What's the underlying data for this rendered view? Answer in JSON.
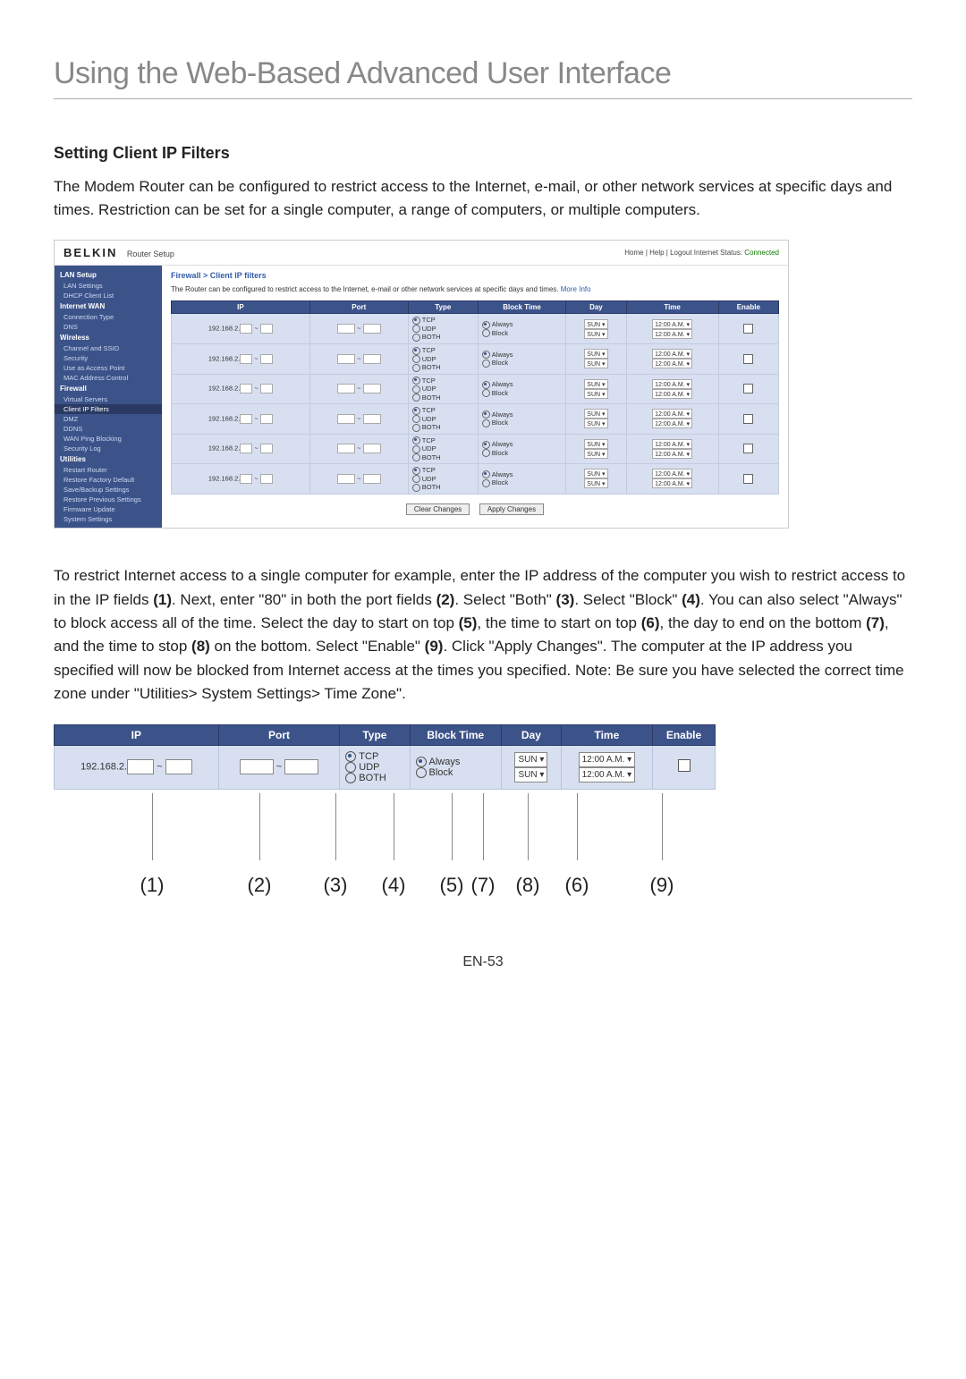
{
  "page": {
    "title": "Using the Web-Based Advanced User Interface",
    "section_title": "Setting Client IP Filters",
    "intro": "The Modem Router can be configured to restrict access to the Internet, e-mail, or other network services at specific days and times. Restriction can be set for a single computer, a range of computers, or multiple computers.",
    "instructions_parts": [
      "To restrict Internet access to a single computer for example, enter the IP address of the computer you wish to restrict access to in the IP fields ",
      "(1)",
      ". Next, enter \"80\" in both the port fields ",
      "(2)",
      ". Select \"Both\" ",
      "(3)",
      ". Select \"Block\" ",
      "(4)",
      ". You can also select \"Always\" to block access all of the time. Select the day to start on top ",
      "(5)",
      ", the time to start on top ",
      "(6)",
      ", the day to end on the bottom ",
      "(7)",
      ", and the time to stop ",
      "(8)",
      " on the bottom. Select \"Enable\" ",
      "(9)",
      ". Click \"Apply Changes\". The computer at the IP address you specified will now be blocked from Internet access at the times you specified. Note: Be sure you have selected the correct time zone under \"Utilities> System Settings> Time Zone\"."
    ],
    "footer": "EN-53"
  },
  "router": {
    "brand": "BELKIN",
    "subtitle": "Router Setup",
    "status_prefix": "Home | Help | Logout   Internet Status:",
    "status_value": "Connected",
    "breadcrumb": "Firewall > Client IP filters",
    "desc": "The Router can be configured to restrict access to the Internet, e-mail or other network services at specific days and times.",
    "more": "More Info",
    "sidebar": [
      {
        "type": "title",
        "label": "LAN Setup"
      },
      {
        "type": "item",
        "label": "LAN Settings"
      },
      {
        "type": "item",
        "label": "DHCP Client List"
      },
      {
        "type": "title",
        "label": "Internet WAN"
      },
      {
        "type": "item",
        "label": "Connection Type"
      },
      {
        "type": "item",
        "label": "DNS"
      },
      {
        "type": "title",
        "label": "Wireless"
      },
      {
        "type": "item",
        "label": "Channel and SSID"
      },
      {
        "type": "item",
        "label": "Security"
      },
      {
        "type": "item",
        "label": "Use as Access Point"
      },
      {
        "type": "item",
        "label": "MAC Address Control"
      },
      {
        "type": "title",
        "label": "Firewall"
      },
      {
        "type": "item",
        "label": "Virtual Servers"
      },
      {
        "type": "item",
        "label": "Client IP Filters",
        "active": true
      },
      {
        "type": "item",
        "label": "DMZ"
      },
      {
        "type": "item",
        "label": "DDNS"
      },
      {
        "type": "item",
        "label": "WAN Ping Blocking"
      },
      {
        "type": "item",
        "label": "Security Log"
      },
      {
        "type": "title",
        "label": "Utilities"
      },
      {
        "type": "item",
        "label": "Restart Router"
      },
      {
        "type": "item",
        "label": "Restore Factory Default"
      },
      {
        "type": "item",
        "label": "Save/Backup Settings"
      },
      {
        "type": "item",
        "label": "Restore Previous Settings"
      },
      {
        "type": "item",
        "label": "Firmware Update"
      },
      {
        "type": "item",
        "label": "System Settings"
      }
    ],
    "table": {
      "headers": [
        "IP",
        "Port",
        "Type",
        "Block Time",
        "Day",
        "Time",
        "Enable"
      ],
      "type_opts": [
        "TCP",
        "UDP",
        "BOTH"
      ],
      "bt_opts": [
        "Always",
        "Block"
      ],
      "ip_prefix": "192.168.2.",
      "day_val": "SUN",
      "time_val": "12:00 A.M.",
      "row_count": 6
    },
    "buttons": {
      "clear": "Clear Changes",
      "apply": "Apply Changes"
    }
  },
  "annot": {
    "headers": [
      "IP",
      "Port",
      "Type",
      "Block Time",
      "Day",
      "Time",
      "Enable"
    ],
    "ip_prefix": "192.168.2.",
    "type_opts": [
      "TCP",
      "UDP",
      "BOTH"
    ],
    "bt_opts": [
      "Always",
      "Block"
    ],
    "day_val": "SUN",
    "time_val": "12:00 A.M.",
    "callouts": [
      "(1)",
      "(2)",
      "(3)",
      "(4)",
      "(5)",
      "(7)",
      "(8)",
      "(6)",
      "(9)"
    ],
    "positions": [
      110,
      230,
      315,
      380,
      445,
      480,
      530,
      585,
      680
    ]
  }
}
